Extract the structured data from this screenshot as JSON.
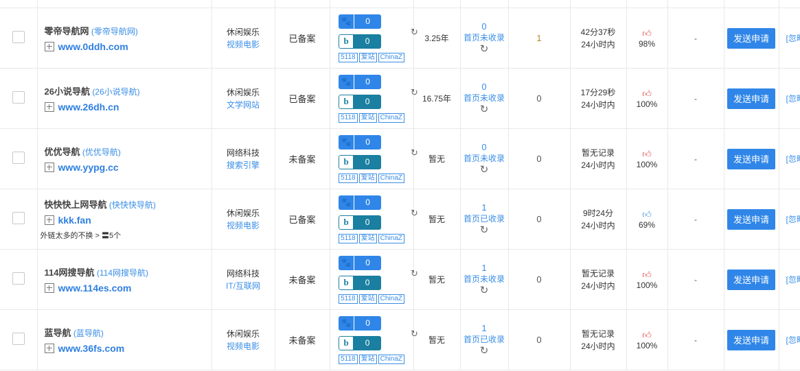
{
  "tags": [
    "5118",
    "爱站",
    "ChinaZ"
  ],
  "action_button": "发送申请",
  "ignore_label": "[忽略",
  "rows": [
    {
      "name": "零帝导航网",
      "alias": "(零帝导航网)",
      "url": "www.0ddh.com",
      "note": "",
      "cat1": "休闲娱乐",
      "cat2": "视频电影",
      "beian": "已备案",
      "baidu": "0",
      "bing": "0",
      "age": "3.25年",
      "idx_num": "0",
      "idx_label": "首页未收录",
      "outlinks": "1",
      "time1": "42分37秒",
      "time2": "24小时内",
      "thumb": "red",
      "percent": "98%",
      "dash": "-"
    },
    {
      "name": "26小说导航",
      "alias": "(26小说导航)",
      "url": "www.26dh.cn",
      "note": "",
      "cat1": "休闲娱乐",
      "cat2": "文学网站",
      "beian": "已备案",
      "baidu": "0",
      "bing": "0",
      "age": "16.75年",
      "idx_num": "0",
      "idx_label": "首页未收录",
      "outlinks": "0",
      "time1": "17分29秒",
      "time2": "24小时内",
      "thumb": "red",
      "percent": "100%",
      "dash": "-"
    },
    {
      "name": "优优导航",
      "alias": "(优优导航)",
      "url": "www.yypg.cc",
      "note": "",
      "cat1": "网络科技",
      "cat2": "搜索引擎",
      "beian": "未备案",
      "baidu": "0",
      "bing": "0",
      "age": "暂无",
      "idx_num": "0",
      "idx_label": "首页未收录",
      "outlinks": "0",
      "time1": "暂无记录",
      "time2": "24小时内",
      "thumb": "red",
      "percent": "100%",
      "dash": "-"
    },
    {
      "name": "快快快上网导航",
      "alias": "(快快快导航)",
      "url": "kkk.fan",
      "note": "外链太多的不换 > 〓5个",
      "cat1": "休闲娱乐",
      "cat2": "视频电影",
      "beian": "已备案",
      "baidu": "0",
      "bing": "0",
      "age": "暂无",
      "idx_num": "1",
      "idx_label": "首页已收录",
      "outlinks": "0",
      "time1": "9时24分",
      "time2": "24小时内",
      "thumb": "blue",
      "percent": "69%",
      "dash": "-"
    },
    {
      "name": "114网搜导航",
      "alias": "(114网搜导航)",
      "url": "www.114es.com",
      "note": "",
      "cat1": "网络科技",
      "cat2": "IT/互联网",
      "beian": "未备案",
      "baidu": "0",
      "bing": "0",
      "age": "暂无",
      "idx_num": "1",
      "idx_label": "首页未收录",
      "outlinks": "0",
      "time1": "暂无记录",
      "time2": "24小时内",
      "thumb": "red",
      "percent": "100%",
      "dash": "-"
    },
    {
      "name": "蓝导航",
      "alias": "(蓝导航)",
      "url": "www.36fs.com",
      "note": "",
      "cat1": "休闲娱乐",
      "cat2": "视频电影",
      "beian": "未备案",
      "baidu": "0",
      "bing": "0",
      "age": "暂无",
      "idx_num": "1",
      "idx_label": "首页已收录",
      "outlinks": "0",
      "time1": "暂无记录",
      "time2": "24小时内",
      "thumb": "red",
      "percent": "100%",
      "dash": "-"
    }
  ]
}
